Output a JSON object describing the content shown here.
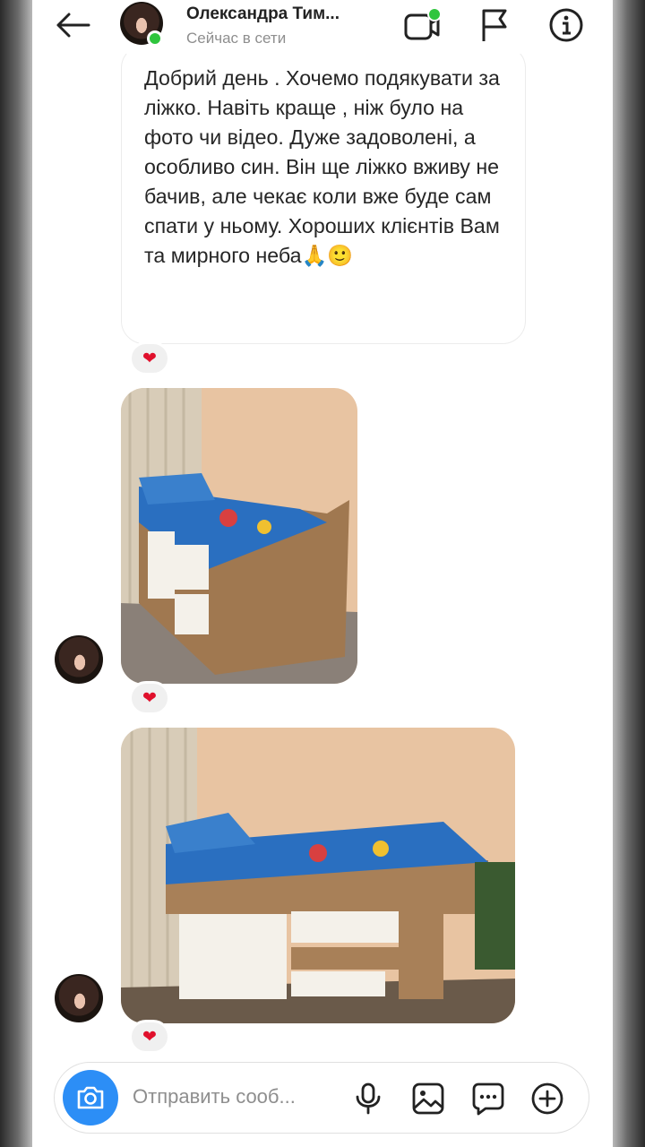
{
  "header": {
    "name": "Олександра Тим...",
    "status": "Сейчас в сети"
  },
  "messages": [
    {
      "text": "Добрий день . Хочемо подякувати за ліжко. Навіть краще , ніж було на фото чи відео. Дуже задоволені, а особливо син. Він ще ліжко вживу не бачив, але чекає коли вже буде сам спати у ньому. Хороших клієнтів Вам та мирного неба🙏🙂",
      "reaction": "❤"
    },
    {
      "type": "photo",
      "reaction": "❤"
    },
    {
      "type": "photo",
      "reaction": "❤"
    }
  ],
  "composer": {
    "placeholder": "Отправить сооб..."
  },
  "icons": [
    "back-arrow-icon",
    "video-call-icon",
    "flag-icon",
    "info-icon",
    "camera-icon",
    "microphone-icon",
    "gallery-icon",
    "sticker-icon",
    "plus-icon",
    "heart-icon"
  ],
  "colors": {
    "accent": "#2c8ef6",
    "online": "#2fc53d",
    "heart": "#e0102c"
  }
}
